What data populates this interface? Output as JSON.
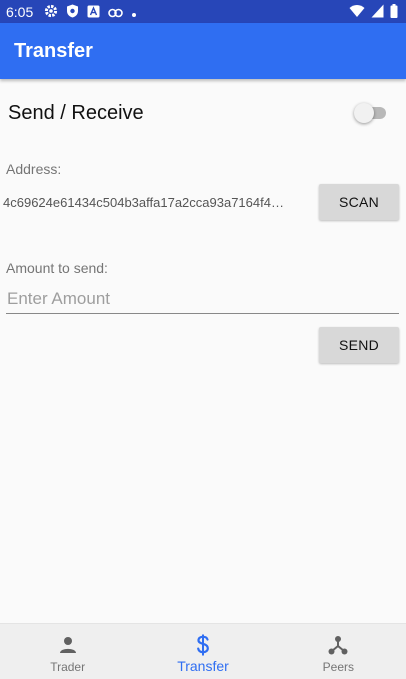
{
  "status_bar": {
    "time": "6:05",
    "icons_left": [
      "gear-icon",
      "shield-icon",
      "a-badge-icon",
      "link-icon",
      "dot-icon"
    ],
    "icons_right": [
      "wifi-icon",
      "signal-icon",
      "battery-icon"
    ]
  },
  "app_bar": {
    "title": "Transfer",
    "color": "#2f6ef2"
  },
  "mode_row": {
    "label": "Send / Receive",
    "toggle_on": false
  },
  "address": {
    "label": "Address:",
    "value": "4c69624e61434c504b3affa17a2cca93a7164f4…"
  },
  "scan_button": {
    "label": "SCAN"
  },
  "amount": {
    "label": "Amount to send:",
    "placeholder": "Enter Amount",
    "value": ""
  },
  "send_button": {
    "label": "SEND"
  },
  "bottom_nav": {
    "items": [
      {
        "label": "Trader",
        "icon": "person-icon",
        "active": false
      },
      {
        "label": "Transfer",
        "icon": "dollar-icon",
        "active": true
      },
      {
        "label": "Peers",
        "icon": "network-icon",
        "active": false
      }
    ],
    "active_color": "#2f6ef2"
  }
}
